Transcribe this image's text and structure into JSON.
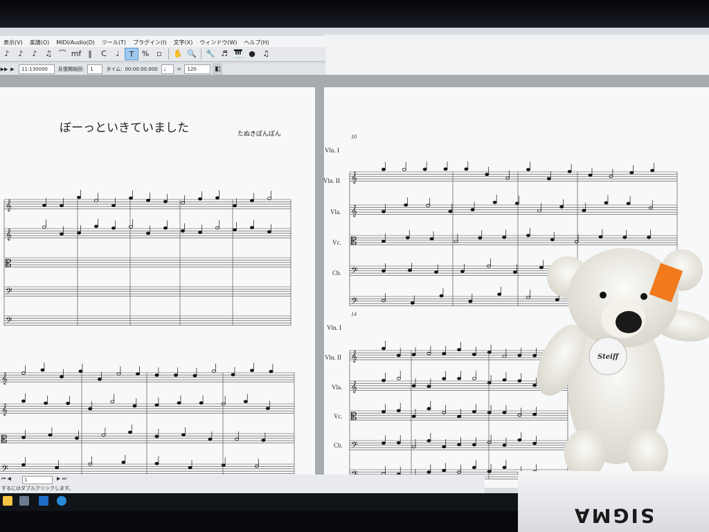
{
  "menu": [
    "表示(V)",
    "楽譜(O)",
    "MIDI/Audio(D)",
    "ツール(T)",
    "プラグイン(I)",
    "文字(X)",
    "ウィンドウ(W)",
    "ヘルプ(H)"
  ],
  "toolbar": {
    "icons": [
      "eighth-note-icon",
      "eighth-note-icon",
      "triplet-icon",
      "beamed-icon",
      "slur-icon",
      "dynamics-icon",
      "barline-icon",
      "articulation-icon",
      "metronome-icon",
      "text-icon",
      "percent-icon",
      "page-icon",
      "hand-icon",
      "zoom-icon",
      "wrench-icon",
      "notes-icon",
      "mixer-icon",
      "sphere-icon",
      "tuplet-icon"
    ],
    "glyphs": [
      "♪",
      "♪",
      "♪",
      "♫",
      "⌒",
      "mf",
      "‖",
      "C",
      "♩",
      "T",
      "%",
      "▫",
      "✋",
      "🔍",
      "🔧",
      "♬",
      "🎹",
      "●",
      "♫"
    ]
  },
  "transport": {
    "position": "11:130000",
    "repeat_label": "反復開始回:",
    "repeat_value": "1",
    "time_label": "タイム:",
    "time_value": "00:00:00.000",
    "tempo_eq": "=",
    "tempo_value": "120"
  },
  "score": {
    "title": "ぼーっといきていました",
    "composer": "たぬきぽんぽん",
    "measure_10": "10",
    "measure_14": "14",
    "instruments": [
      "Vln. I",
      "Vln. II",
      "Vla.",
      "Vc.",
      "Cb."
    ]
  },
  "status": {
    "page_field": "1",
    "hint": "するにはダブルクリックします。"
  },
  "monitor_brand": "SIGMA",
  "colors": {
    "accent": "#3a7ec4",
    "page": "#f7f8f9",
    "workspace": "#a7abb0"
  }
}
